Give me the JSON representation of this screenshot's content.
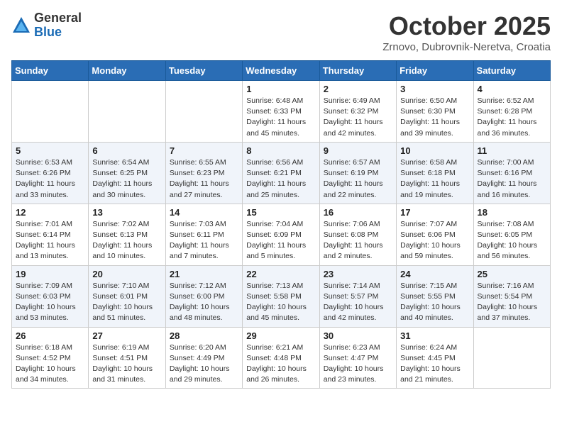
{
  "header": {
    "logo_general": "General",
    "logo_blue": "Blue",
    "month": "October 2025",
    "location": "Zrnovo, Dubrovnik-Neretva, Croatia"
  },
  "weekdays": [
    "Sunday",
    "Monday",
    "Tuesday",
    "Wednesday",
    "Thursday",
    "Friday",
    "Saturday"
  ],
  "weeks": [
    [
      {
        "day": "",
        "info": ""
      },
      {
        "day": "",
        "info": ""
      },
      {
        "day": "",
        "info": ""
      },
      {
        "day": "1",
        "info": "Sunrise: 6:48 AM\nSunset: 6:33 PM\nDaylight: 11 hours\nand 45 minutes."
      },
      {
        "day": "2",
        "info": "Sunrise: 6:49 AM\nSunset: 6:32 PM\nDaylight: 11 hours\nand 42 minutes."
      },
      {
        "day": "3",
        "info": "Sunrise: 6:50 AM\nSunset: 6:30 PM\nDaylight: 11 hours\nand 39 minutes."
      },
      {
        "day": "4",
        "info": "Sunrise: 6:52 AM\nSunset: 6:28 PM\nDaylight: 11 hours\nand 36 minutes."
      }
    ],
    [
      {
        "day": "5",
        "info": "Sunrise: 6:53 AM\nSunset: 6:26 PM\nDaylight: 11 hours\nand 33 minutes."
      },
      {
        "day": "6",
        "info": "Sunrise: 6:54 AM\nSunset: 6:25 PM\nDaylight: 11 hours\nand 30 minutes."
      },
      {
        "day": "7",
        "info": "Sunrise: 6:55 AM\nSunset: 6:23 PM\nDaylight: 11 hours\nand 27 minutes."
      },
      {
        "day": "8",
        "info": "Sunrise: 6:56 AM\nSunset: 6:21 PM\nDaylight: 11 hours\nand 25 minutes."
      },
      {
        "day": "9",
        "info": "Sunrise: 6:57 AM\nSunset: 6:19 PM\nDaylight: 11 hours\nand 22 minutes."
      },
      {
        "day": "10",
        "info": "Sunrise: 6:58 AM\nSunset: 6:18 PM\nDaylight: 11 hours\nand 19 minutes."
      },
      {
        "day": "11",
        "info": "Sunrise: 7:00 AM\nSunset: 6:16 PM\nDaylight: 11 hours\nand 16 minutes."
      }
    ],
    [
      {
        "day": "12",
        "info": "Sunrise: 7:01 AM\nSunset: 6:14 PM\nDaylight: 11 hours\nand 13 minutes."
      },
      {
        "day": "13",
        "info": "Sunrise: 7:02 AM\nSunset: 6:13 PM\nDaylight: 11 hours\nand 10 minutes."
      },
      {
        "day": "14",
        "info": "Sunrise: 7:03 AM\nSunset: 6:11 PM\nDaylight: 11 hours\nand 7 minutes."
      },
      {
        "day": "15",
        "info": "Sunrise: 7:04 AM\nSunset: 6:09 PM\nDaylight: 11 hours\nand 5 minutes."
      },
      {
        "day": "16",
        "info": "Sunrise: 7:06 AM\nSunset: 6:08 PM\nDaylight: 11 hours\nand 2 minutes."
      },
      {
        "day": "17",
        "info": "Sunrise: 7:07 AM\nSunset: 6:06 PM\nDaylight: 10 hours\nand 59 minutes."
      },
      {
        "day": "18",
        "info": "Sunrise: 7:08 AM\nSunset: 6:05 PM\nDaylight: 10 hours\nand 56 minutes."
      }
    ],
    [
      {
        "day": "19",
        "info": "Sunrise: 7:09 AM\nSunset: 6:03 PM\nDaylight: 10 hours\nand 53 minutes."
      },
      {
        "day": "20",
        "info": "Sunrise: 7:10 AM\nSunset: 6:01 PM\nDaylight: 10 hours\nand 51 minutes."
      },
      {
        "day": "21",
        "info": "Sunrise: 7:12 AM\nSunset: 6:00 PM\nDaylight: 10 hours\nand 48 minutes."
      },
      {
        "day": "22",
        "info": "Sunrise: 7:13 AM\nSunset: 5:58 PM\nDaylight: 10 hours\nand 45 minutes."
      },
      {
        "day": "23",
        "info": "Sunrise: 7:14 AM\nSunset: 5:57 PM\nDaylight: 10 hours\nand 42 minutes."
      },
      {
        "day": "24",
        "info": "Sunrise: 7:15 AM\nSunset: 5:55 PM\nDaylight: 10 hours\nand 40 minutes."
      },
      {
        "day": "25",
        "info": "Sunrise: 7:16 AM\nSunset: 5:54 PM\nDaylight: 10 hours\nand 37 minutes."
      }
    ],
    [
      {
        "day": "26",
        "info": "Sunrise: 6:18 AM\nSunset: 4:52 PM\nDaylight: 10 hours\nand 34 minutes."
      },
      {
        "day": "27",
        "info": "Sunrise: 6:19 AM\nSunset: 4:51 PM\nDaylight: 10 hours\nand 31 minutes."
      },
      {
        "day": "28",
        "info": "Sunrise: 6:20 AM\nSunset: 4:49 PM\nDaylight: 10 hours\nand 29 minutes."
      },
      {
        "day": "29",
        "info": "Sunrise: 6:21 AM\nSunset: 4:48 PM\nDaylight: 10 hours\nand 26 minutes."
      },
      {
        "day": "30",
        "info": "Sunrise: 6:23 AM\nSunset: 4:47 PM\nDaylight: 10 hours\nand 23 minutes."
      },
      {
        "day": "31",
        "info": "Sunrise: 6:24 AM\nSunset: 4:45 PM\nDaylight: 10 hours\nand 21 minutes."
      },
      {
        "day": "",
        "info": ""
      }
    ]
  ]
}
